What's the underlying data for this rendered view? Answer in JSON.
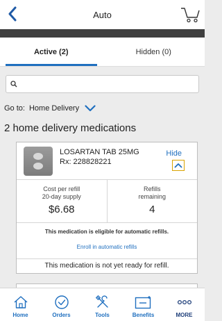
{
  "header": {
    "title": "Auto"
  },
  "tabs": [
    {
      "label": "Active (2)",
      "active": true
    },
    {
      "label": "Hidden (0)",
      "active": false
    }
  ],
  "search": {
    "placeholder": "",
    "value": ""
  },
  "goto": {
    "label": "Go to:",
    "value": "Home Delivery"
  },
  "section_title": "2 home delivery medications",
  "medication": {
    "name": "LOSARTAN TAB 25MG",
    "rx": "Rx: 228828221",
    "hide_label": "Hide",
    "cost_label_line1": "Cost per refill",
    "cost_label_line2": "20-day supply",
    "cost_value": "$6.68",
    "refills_label_line1": "Refills",
    "refills_label_line2": "remaining",
    "refills_value": "4",
    "eligible_msg": "This medication is eligible for automatic refills.",
    "enroll_label": "Enroll in automatic refills",
    "status": "This medication is not yet ready for refill."
  },
  "bottom_nav": [
    {
      "label": "Home",
      "icon": "home-icon"
    },
    {
      "label": "Orders",
      "icon": "check-circle-icon"
    },
    {
      "label": "Tools",
      "icon": "tools-icon"
    },
    {
      "label": "Benefits",
      "icon": "benefits-icon"
    },
    {
      "label": "MORE",
      "icon": "more-dots-icon"
    }
  ],
  "colors": {
    "accent": "#1f6fbf",
    "dark_bar": "#3f3f3f",
    "highlight": "#d9a300"
  }
}
